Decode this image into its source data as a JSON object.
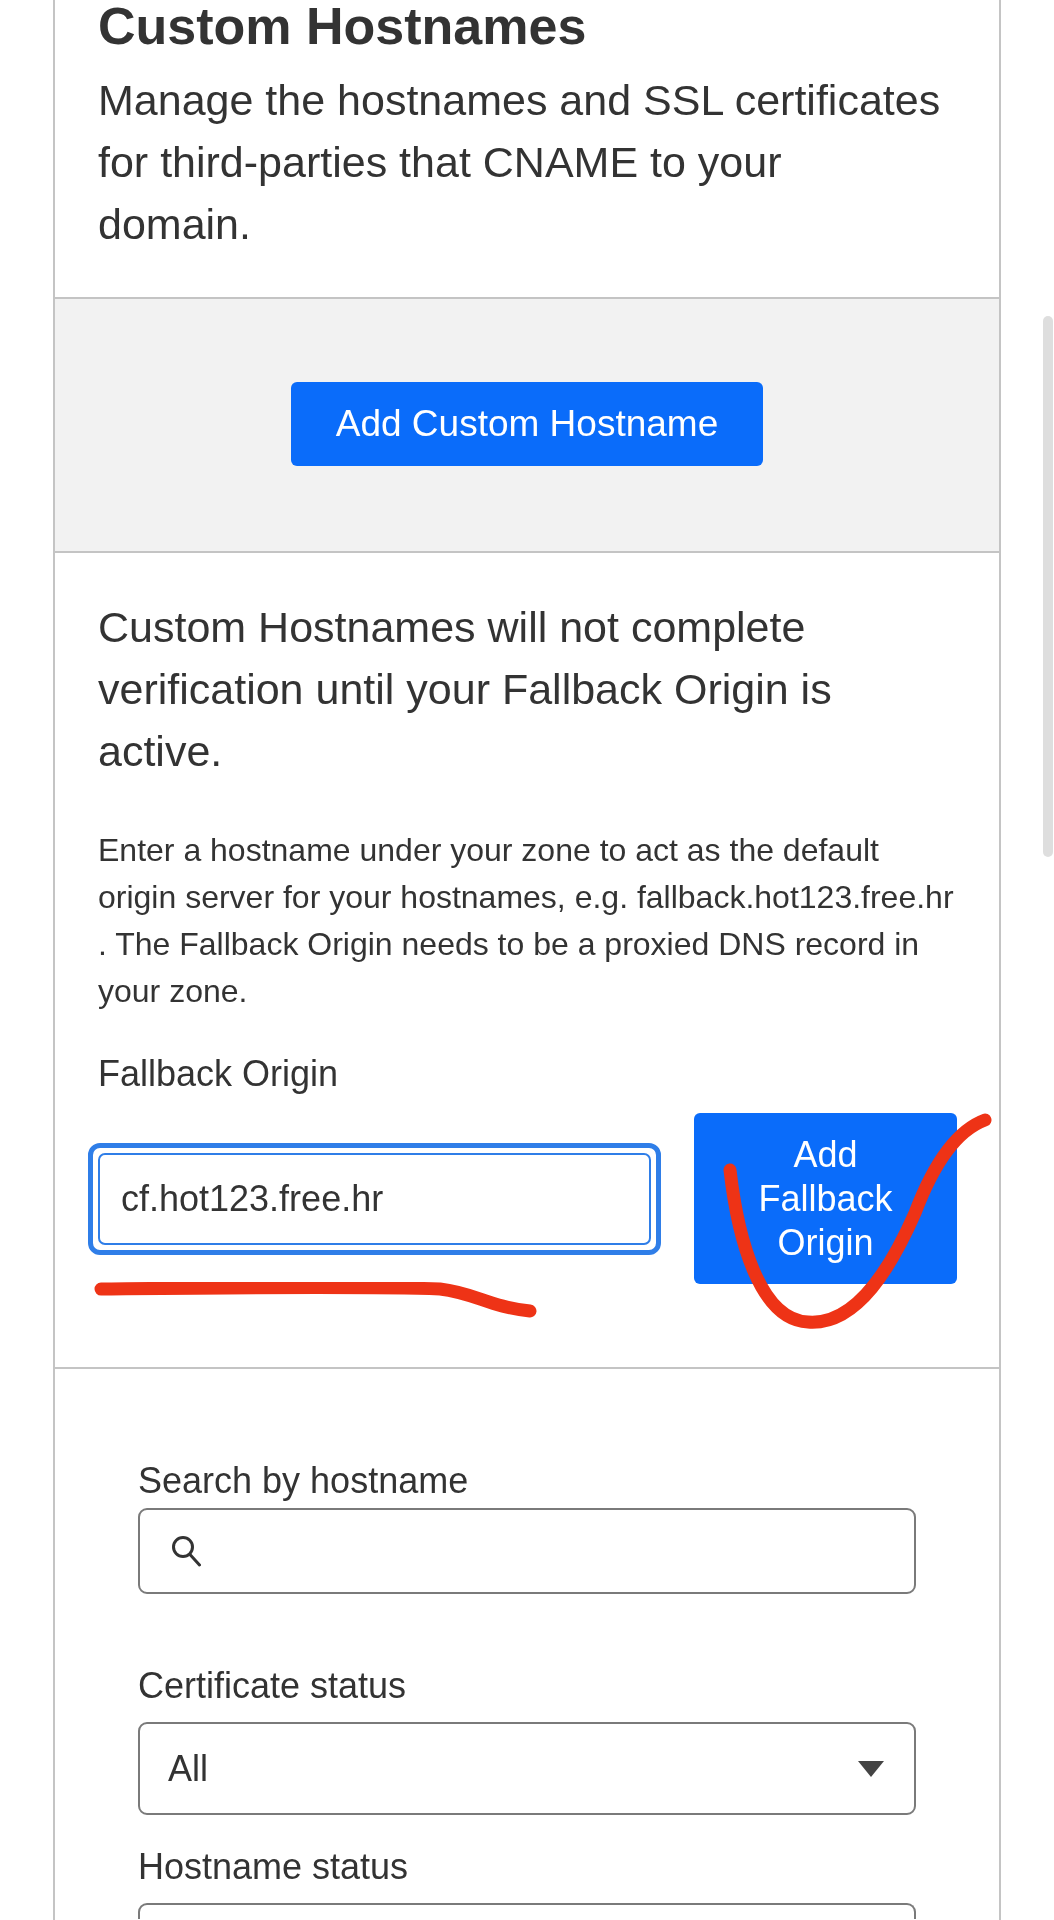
{
  "header": {
    "title": "Custom Hostnames",
    "description": "Manage the hostnames and SSL certificates for third-parties that CNAME to your domain."
  },
  "actions": {
    "add_button": "Add Custom Hostname"
  },
  "fallback": {
    "notice": "Custom Hostnames will not complete verification until your Fallback Origin is active.",
    "help": "Enter a hostname under your zone to act as the default origin server for your hostnames, e.g. fallback.hot123.free.hr . The Fallback Origin needs to be a proxied DNS record in your zone.",
    "field": {
      "label": "Fallback Origin",
      "value": "cf.hot123.free.hr",
      "focused": true,
      "annotation": {
        "kind": "underline"
      }
    },
    "button": {
      "label": "Add Fallback Origin",
      "annotation": {
        "kind": "checkmark"
      }
    }
  },
  "filters": [
    {
      "kind": "search",
      "label": "Search by hostname"
    },
    {
      "kind": "select",
      "label": "Certificate status",
      "value": "All"
    },
    {
      "kind": "select",
      "label": "Hostname status"
    }
  ]
}
